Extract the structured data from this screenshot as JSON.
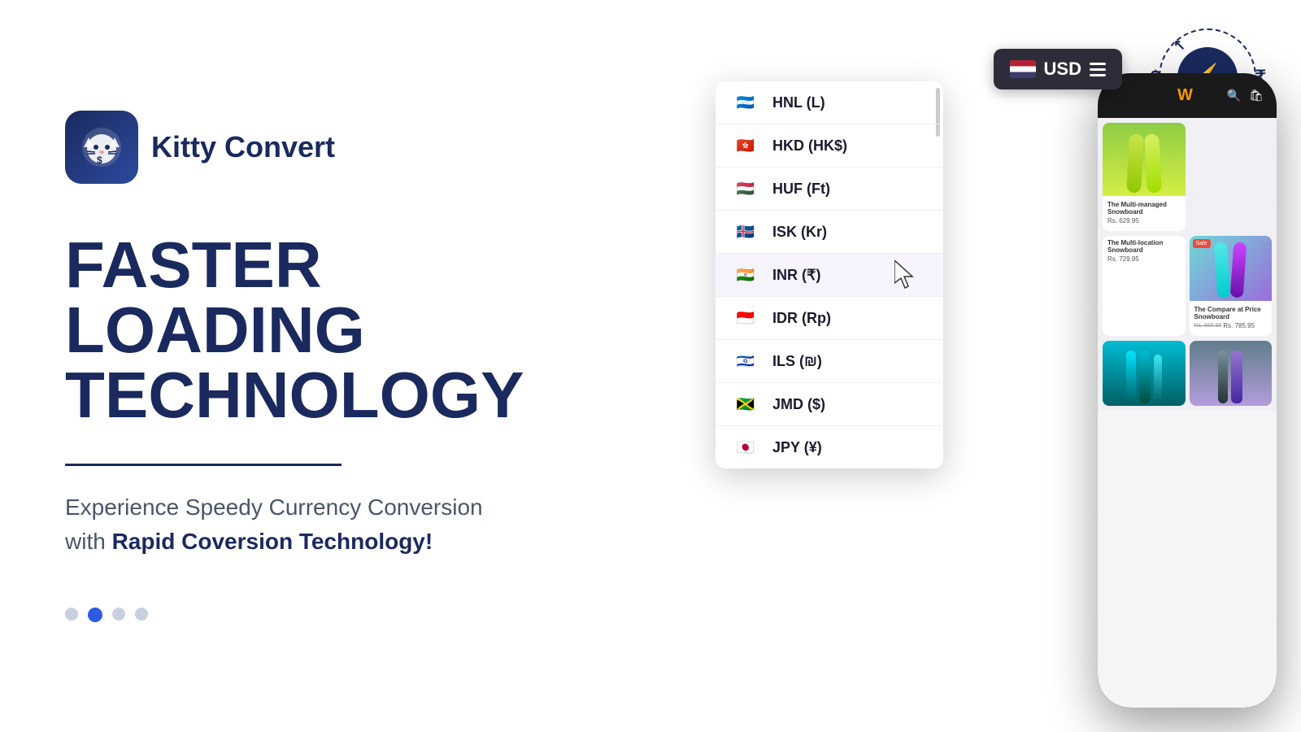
{
  "app": {
    "name": "Kitty Convert",
    "logo_alt": "kitty-convert-logo"
  },
  "header": {
    "currency_badge": "USD",
    "currency_flag": "🇺🇸"
  },
  "hero": {
    "headline_line1": "FASTER LOADING",
    "headline_line2": "TECHNOLOGY",
    "subtext_normal": "Experience Speedy Currency Conversion with ",
    "subtext_bold": "Rapid Coversion Technology!",
    "divider": true
  },
  "dots": [
    {
      "active": false
    },
    {
      "active": true
    },
    {
      "active": false
    },
    {
      "active": false
    }
  ],
  "conversion_icon": {
    "symbol_left": "$",
    "symbol_right": "₹",
    "bolt": "⚡"
  },
  "dropdown": {
    "items": [
      {
        "flag": "🇭🇳",
        "code": "HNL",
        "symbol": "(L)"
      },
      {
        "flag": "🇭🇰",
        "code": "HKD",
        "symbol": "(HK$)"
      },
      {
        "flag": "🇭🇺",
        "code": "HUF",
        "symbol": "(Ft)"
      },
      {
        "flag": "🇮🇸",
        "code": "ISK",
        "symbol": "(Kr)"
      },
      {
        "flag": "🇮🇳",
        "code": "INR",
        "symbol": "(₹)",
        "highlighted": true
      },
      {
        "flag": "🇮🇩",
        "code": "IDR",
        "symbol": "(Rp)"
      },
      {
        "flag": "🇮🇱",
        "code": "ILS",
        "symbol": "(₪)"
      },
      {
        "flag": "🇯🇲",
        "code": "JMD",
        "symbol": "($)"
      },
      {
        "flag": "🇯🇵",
        "code": "JPY",
        "symbol": "(¥)"
      }
    ]
  },
  "phone": {
    "header_logo": "W",
    "products": [
      {
        "name": "The Multi-managed Snowboard",
        "price": "Rs. 629.95",
        "type": "snowboard1"
      },
      {
        "name": "The Multi-location Snowboard",
        "price": "Rs. 729.95",
        "type": "snowboard2",
        "sale": true,
        "original_price": "Rs. 865.95",
        "sale_price": "Rs. 785.95"
      }
    ]
  },
  "colors": {
    "brand_dark": "#1a2a5e",
    "brand_blue": "#2d5be3",
    "accent_orange": "#ff9900",
    "bg_white": "#ffffff"
  }
}
